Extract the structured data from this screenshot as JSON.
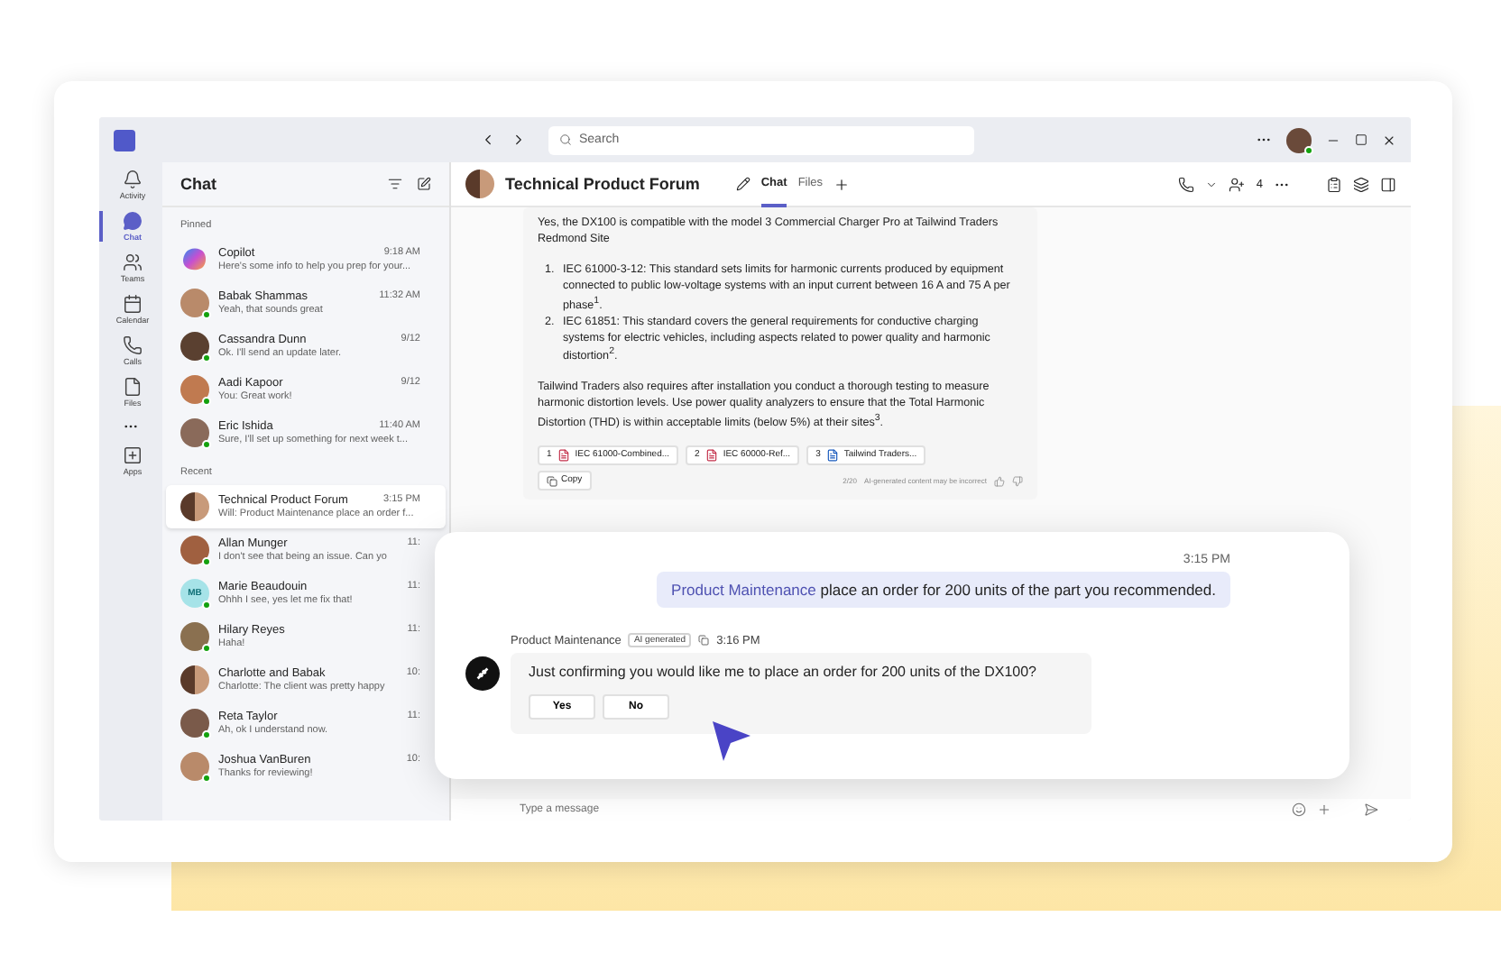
{
  "top_bar": {
    "search": {
      "placeholder": "Search"
    }
  },
  "rail": [
    {
      "label": "Activity",
      "selected": false
    },
    {
      "label": "Chat",
      "selected": true
    },
    {
      "label": "Teams",
      "selected": false
    },
    {
      "label": "Calendar",
      "selected": false
    },
    {
      "label": "Calls",
      "selected": false
    },
    {
      "label": "Files",
      "selected": false
    },
    {
      "label": "Apps",
      "selected": false
    }
  ],
  "chat_list": {
    "title": "Chat",
    "sections": [
      {
        "label": "Pinned",
        "items": [
          {
            "name": "Copilot",
            "time": "9:18 AM",
            "preview": "Here's some info to help you prep for your...",
            "kind": "copilot",
            "selected": false
          },
          {
            "name": "Babak Shammas",
            "time": "11:32 AM",
            "preview": "Yeah, that sounds great",
            "kind": "person",
            "selected": false
          },
          {
            "name": "Cassandra Dunn",
            "time": "9/12",
            "preview": "Ok. I'll send an update later.",
            "kind": "person",
            "selected": false
          },
          {
            "name": "Aadi Kapoor",
            "time": "9/12",
            "preview": "You: Great work!",
            "kind": "person",
            "selected": false
          },
          {
            "name": "Eric Ishida",
            "time": "11:40 AM",
            "preview": "Sure, I'll set up something for next week t...",
            "kind": "person",
            "selected": false
          }
        ]
      },
      {
        "label": "Recent",
        "items": [
          {
            "name": "Technical Product Forum",
            "time": "3:15 PM",
            "preview": "Will: Product Maintenance place an order f...",
            "kind": "group",
            "selected": true
          },
          {
            "name": "Allan Munger",
            "time": "11:",
            "preview": "I don't see that being an issue. Can yo",
            "kind": "person",
            "selected": false
          },
          {
            "name": "Marie Beaudouin",
            "time": "11:",
            "preview": "Ohhh I see, yes let me fix that!",
            "kind": "initials",
            "initials": "MB",
            "selected": false
          },
          {
            "name": "Hilary Reyes",
            "time": "11:",
            "preview": "Haha!",
            "kind": "person",
            "selected": false
          },
          {
            "name": "Charlotte and Babak",
            "time": "10:",
            "preview": "Charlotte: The client was pretty happy",
            "kind": "group",
            "selected": false
          },
          {
            "name": "Reta Taylor",
            "time": "11:",
            "preview": "Ah, ok I understand now.",
            "kind": "person",
            "selected": false
          },
          {
            "name": "Joshua VanBuren",
            "time": "10:",
            "preview": "Thanks for reviewing!",
            "kind": "person",
            "selected": false
          }
        ]
      }
    ]
  },
  "conversation": {
    "title": "Technical Product Forum",
    "tabs": [
      {
        "label": "Chat",
        "selected": true
      },
      {
        "label": "Files",
        "selected": false
      }
    ],
    "participants": "4",
    "reply": {
      "intro": "Yes, the DX100 is compatible with the model 3 Commercial Charger Pro at Tailwind Traders Redmond Site",
      "list": [
        {
          "number": "1.",
          "text": "IEC 61000-3-12: This standard sets limits for harmonic currents produced by equipment connected to public low-voltage systems with an input current between 16 A and 75 A per phase$^{1}$."
        },
        {
          "number": "2.",
          "text": "IEC 61851: This standard covers the general requirements for conductive charging systems for electric vehicles, including aspects related to power quality and harmonic distortion$^{2}$."
        }
      ],
      "outro": "Tailwind Traders also requires after installation you conduct a thorough testing to measure harmonic distortion levels. Use power quality analyzers to ensure that the Total Harmonic Distortion (THD) is within acceptable limits (below 5%) at their sites$^{3}$.",
      "references": [
        {
          "number": "1",
          "title": "IEC 61000-Combined...",
          "kind": "pdf"
        },
        {
          "number": "2",
          "title": "IEC 60000-Ref...",
          "kind": "pdf"
        },
        {
          "number": "3",
          "title": "Tailwind Traders...",
          "kind": "doc"
        }
      ],
      "copy": "Copy",
      "count": "2/20",
      "disclaimer": "AI-generated content may be incorrect"
    },
    "compose": {
      "placeholder": "Type a message"
    }
  },
  "focus_card": {
    "sent": {
      "time": "3:15 PM",
      "mention": "Product Maintenance",
      "text": "place an order for 200 units of the part you recommended."
    },
    "bot": {
      "name": "Product Maintenance",
      "badge": "AI generated",
      "time": "3:16 PM",
      "text": "Just confirming you would like me to place an order for 200 units of the DX100?",
      "buttons": [
        "Yes",
        "No"
      ]
    }
  }
}
